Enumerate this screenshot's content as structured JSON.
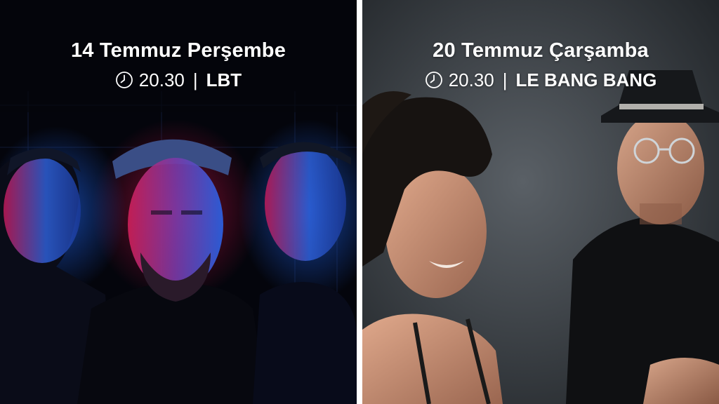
{
  "events": [
    {
      "date": "14 Temmuz Perşembe",
      "time": "20.30",
      "separator": "|",
      "venue": "LBT",
      "icon": "clock-icon"
    },
    {
      "date": "20 Temmuz Çarşamba",
      "time": "20.30",
      "separator": "|",
      "venue": "LE BANG BANG",
      "icon": "clock-icon"
    }
  ],
  "colors": {
    "text": "#ffffff",
    "divider": "#ffffff",
    "left_bg": "#05060d",
    "right_bg": "#3a3f44"
  }
}
